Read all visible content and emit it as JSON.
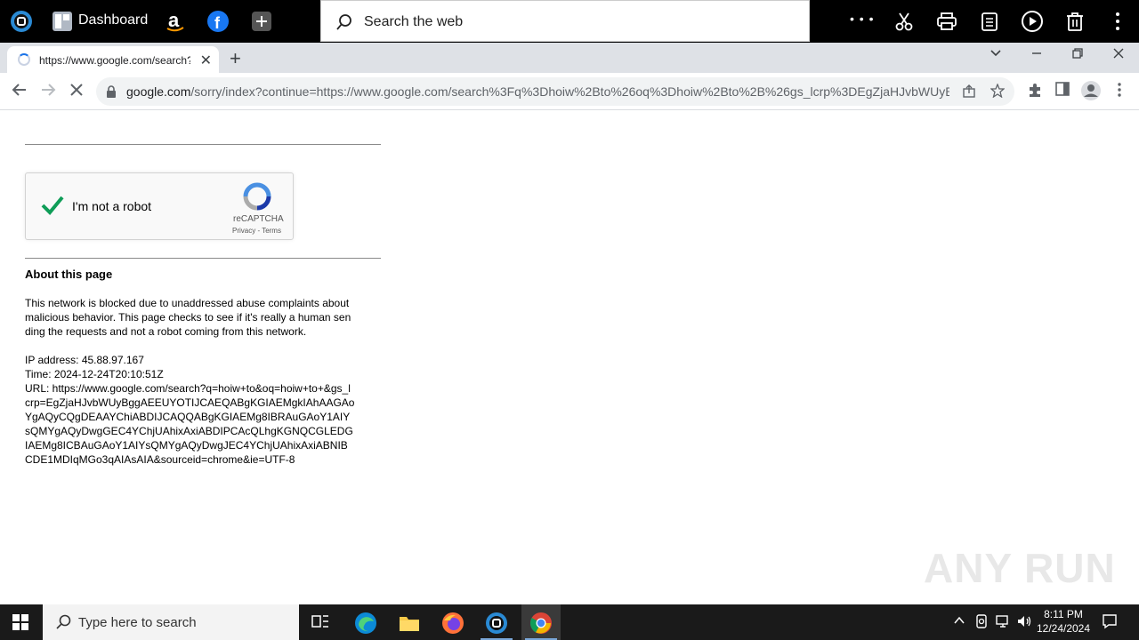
{
  "launcher": {
    "dashboard_label": "Dashboard",
    "search_placeholder": "Search the web",
    "more_label": "• • •"
  },
  "tab": {
    "title": "https://www.google.com/search?q=hoiw",
    "close_glyph": "✕",
    "new_tab_glyph": "+"
  },
  "address": {
    "host": "google.com",
    "path": "/sorry/index?continue=https://www.google.com/search%3Fq%3Dhoiw%2Bto%26oq%3Dhoiw%2Bto%2B%26gs_lcrp%3DEgZjaHJvbWUyBg..."
  },
  "captcha": {
    "label": "I'm not a robot",
    "brand": "reCAPTCHA",
    "links": "Privacy - Terms"
  },
  "page": {
    "about_title": "About this page",
    "message_lines": [
      "This network is blocked due to unaddressed abuse complaints about",
      "malicious behavior. This page checks to see if it's really a human sen",
      "ding the requests and not a robot coming from this network."
    ],
    "ip_line": "IP address: 45.88.97.167",
    "time_line": "Time: 2024-12-24T20:10:51Z",
    "url_lines": [
      "URL: https://www.google.com/search?q=hoiw+to&oq=hoiw+to+&gs_l",
      "crp=EgZjaHJvbWUyBggAEEUYOTIJCAEQABgKGIAEMgkIAhAAGAo",
      "YgAQyCQgDEAAYChiABDIJCAQQABgKGIAEMg8IBRAuGAoY1AIY",
      "sQMYgAQyDwgGEC4YChjUAhixAxiABDIPCAcQLhgKGNQCGLEDG",
      "IAEMg8ICBAuGAoY1AIYsQMYgAQyDwgJEC4YChjUAhixAxiABNIB",
      "CDE1MDIqMGo3qAIAsAIA&sourceid=chrome&ie=UTF-8"
    ]
  },
  "watermark": "ANY RUN",
  "taskbar": {
    "search_placeholder": "Type here to search",
    "time": "8:11 PM",
    "date": "12/24/2024"
  },
  "colors": {
    "check_green": "#0f9d58",
    "chrome_tabstrip": "#dee1e6",
    "omnibox": "#f1f3f4",
    "taskbar": "#1a1a1a"
  }
}
